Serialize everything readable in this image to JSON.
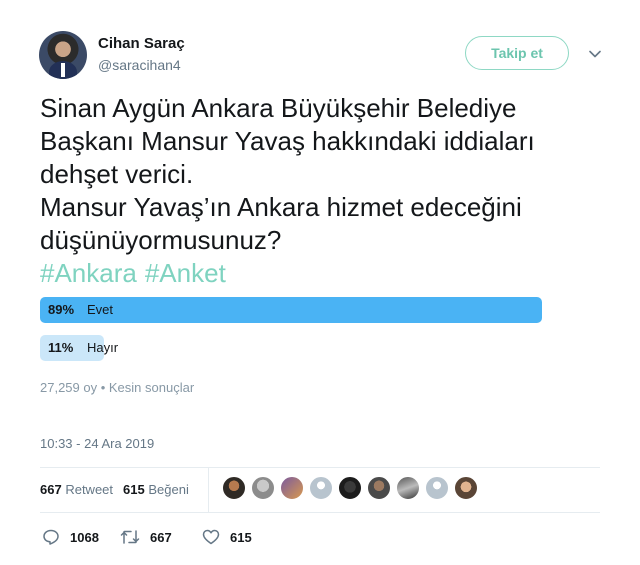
{
  "author": {
    "name": "Cihan Saraç",
    "handle": "@saracihan4"
  },
  "follow_button": "Takip et",
  "tweet": {
    "lines": [
      "Sinan Aygün Ankara Büyükşehir Belediye",
      "Başkanı Mansur Yavaş hakkındaki iddiaları",
      "dehşet verici.",
      "Mansur Yavaş’ın Ankara hizmet edeceğini",
      "düşünüyormusunuz?"
    ],
    "hashtags": [
      "#Ankara",
      "#Anket"
    ]
  },
  "poll": {
    "options": [
      {
        "percent_label": "89%",
        "label": "Evet",
        "percent": 89,
        "winner": true
      },
      {
        "percent_label": "11%",
        "label": "Hayır",
        "percent": 11,
        "winner": false
      }
    ],
    "meta": "27,259 oy • Kesin sonuçlar"
  },
  "timestamp": "10:33 - 24 Ara 2019",
  "stats": {
    "retweets_count": "667",
    "retweets_label": "Retweet",
    "likes_count": "615",
    "likes_label": "Beğeni"
  },
  "likers": [
    "avatar-1",
    "avatar-2",
    "avatar-3",
    "avatar-4",
    "avatar-5",
    "avatar-6",
    "avatar-7",
    "avatar-8",
    "avatar-9"
  ],
  "actions": {
    "reply_count": "1068",
    "retweet_count": "667",
    "like_count": "615"
  },
  "colors": {
    "poll_winner": "#4ab3f4",
    "poll_loser": "#cbe7f9",
    "hashtag": "#7fd3c0",
    "follow_border": "#8ed8c4"
  },
  "icons": [
    "chevron-down-icon",
    "reply-icon",
    "retweet-icon",
    "like-icon"
  ]
}
